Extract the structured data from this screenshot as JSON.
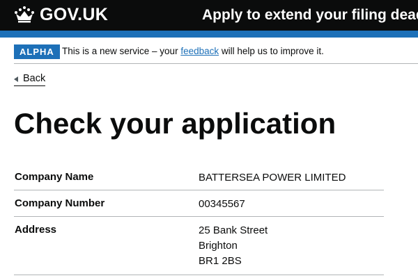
{
  "header": {
    "logo_text": "GOV.UK",
    "service_name": "Apply to extend your filing deadline",
    "colors": {
      "background": "#0b0c0c",
      "accent_bar": "#1d70b8"
    },
    "logo_icon": "crown-icon"
  },
  "phase_banner": {
    "tag": "ALPHA",
    "text_before": "This is a new service – your ",
    "link_text": "feedback",
    "text_after": " will help us to improve it."
  },
  "back_link": {
    "label": "Back",
    "icon": "back-arrow-icon"
  },
  "page_title": "Check your application",
  "summary": {
    "rows": [
      {
        "key": "Company Name",
        "lines": [
          "BATTERSEA POWER LIMITED"
        ]
      },
      {
        "key": "Company Number",
        "lines": [
          "00345567"
        ]
      },
      {
        "key": "Address",
        "lines": [
          "25 Bank Street",
          "Brighton",
          "BR1 2BS"
        ]
      }
    ]
  }
}
